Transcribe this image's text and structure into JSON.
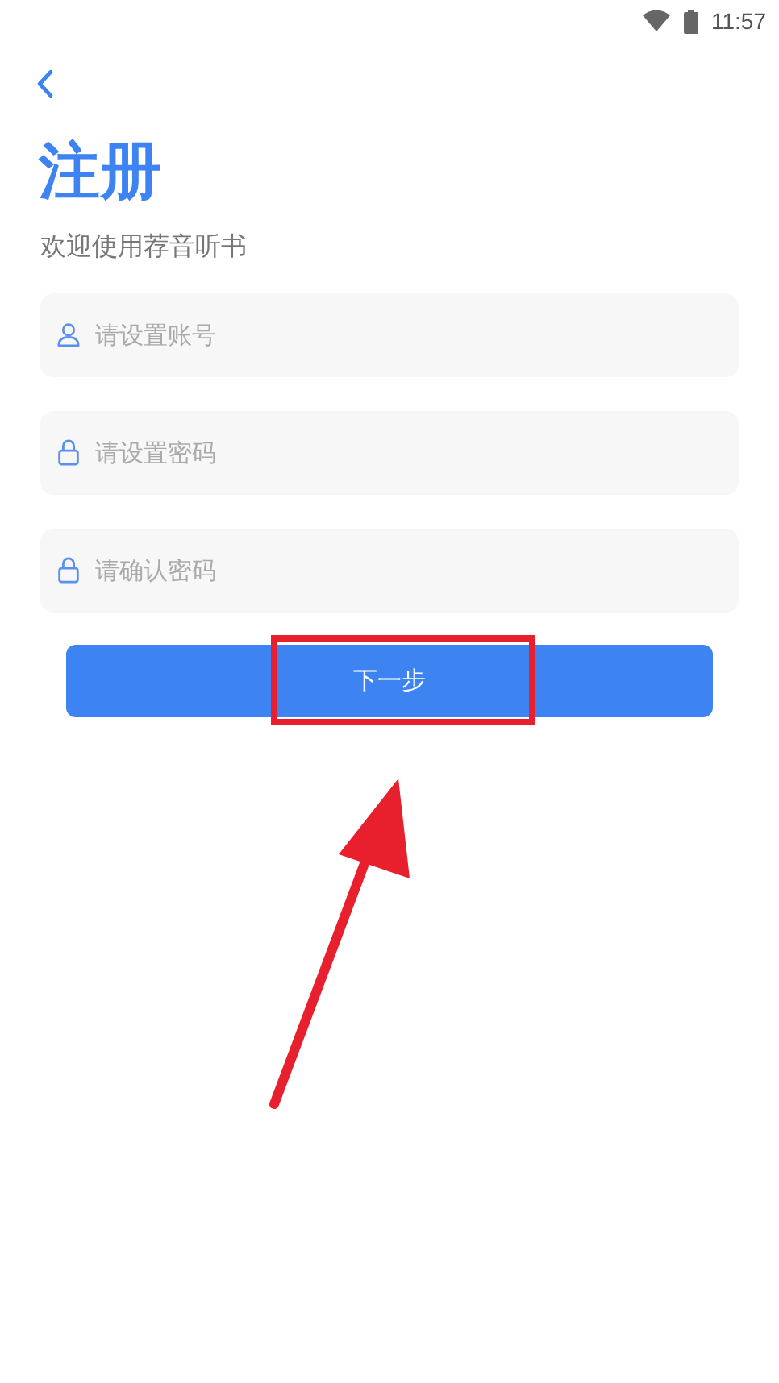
{
  "status_bar": {
    "time": "11:57"
  },
  "title": "注册",
  "subtitle": "欢迎使用荐音听书",
  "fields": [
    {
      "kind": "user",
      "placeholder": "请设置账号"
    },
    {
      "kind": "lock",
      "placeholder": "请设置密码"
    },
    {
      "kind": "lock",
      "placeholder": "请确认密码"
    }
  ],
  "next_button": {
    "label": "下一步"
  }
}
